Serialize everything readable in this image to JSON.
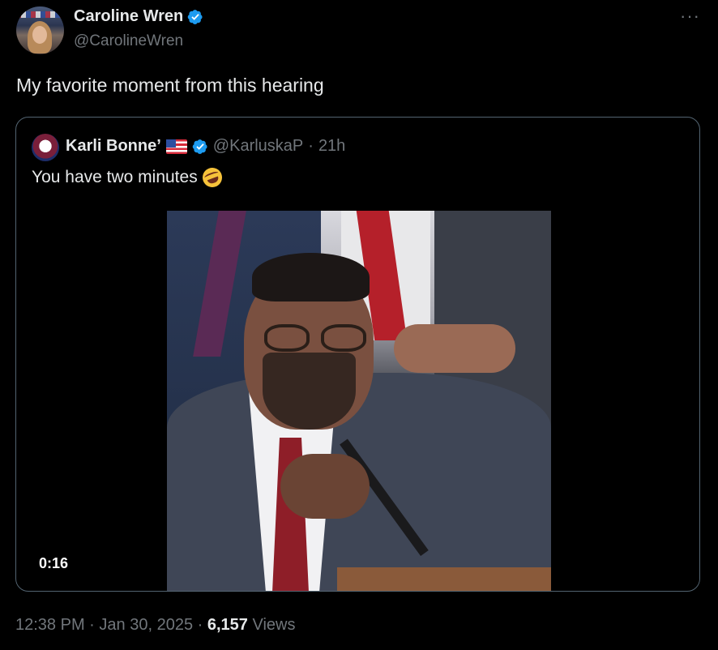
{
  "post": {
    "author_name": "Caroline Wren",
    "author_handle": "@CarolineWren",
    "more_label": "···",
    "text": "My favorite moment from this hearing",
    "time": "12:38 PM",
    "separator": "·",
    "date": "Jan 30, 2025",
    "views_count": "6,157",
    "views_label": "Views"
  },
  "quote": {
    "author_name": "Karli Bonne’",
    "author_handle": "@KarluskaP",
    "separator": "·",
    "age": "21h",
    "text": "You have two minutes",
    "video_duration": "0:16"
  },
  "icons": {
    "verified": "verified-badge-icon",
    "flag": "us-flag-icon",
    "emoji": "rolling-on-floor-laughing-emoji",
    "more": "more-options-icon"
  },
  "colors": {
    "background": "#000000",
    "primary_text": "#e7e9ea",
    "secondary_text": "#71767b",
    "verified_blue": "#1d9bf0",
    "quote_border": "#536471"
  }
}
